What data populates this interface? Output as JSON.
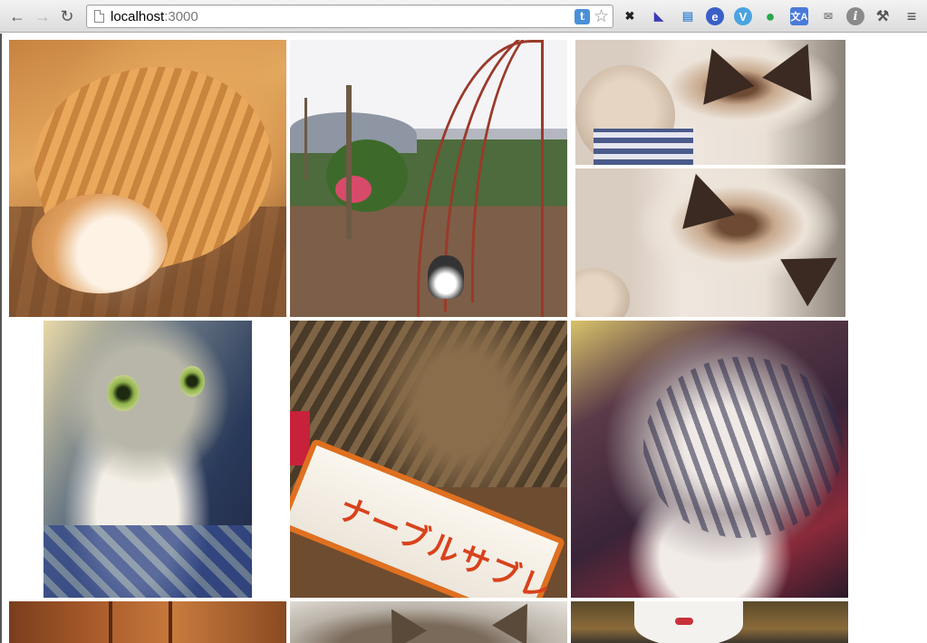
{
  "browser": {
    "back_icon": "arrow-left-icon",
    "forward_icon": "arrow-right-icon",
    "reload_icon": "reload-icon",
    "url_host": "localhost",
    "url_port": ":3000",
    "extensions": [
      {
        "name": "pin-icon",
        "color": "#222222"
      },
      {
        "name": "mask-icon",
        "color": "#3b3bb8"
      },
      {
        "name": "folder-icon",
        "color": "#4a90d9"
      },
      {
        "name": "e-icon",
        "color": "#3a5fc8"
      },
      {
        "name": "v-icon",
        "color": "#4aa3e0"
      },
      {
        "name": "leaf-icon",
        "color": "#2aa84a"
      },
      {
        "name": "translate-icon",
        "color": "#4a7ad9"
      },
      {
        "name": "mail-icon",
        "color": "#8a8a8a"
      },
      {
        "name": "info-icon",
        "color": "#777777"
      },
      {
        "name": "wrench-icon",
        "color": "#555555"
      },
      {
        "name": "menu-icon",
        "color": "#444444"
      }
    ]
  },
  "gallery": {
    "package_text": "ナーブルサブレ"
  }
}
